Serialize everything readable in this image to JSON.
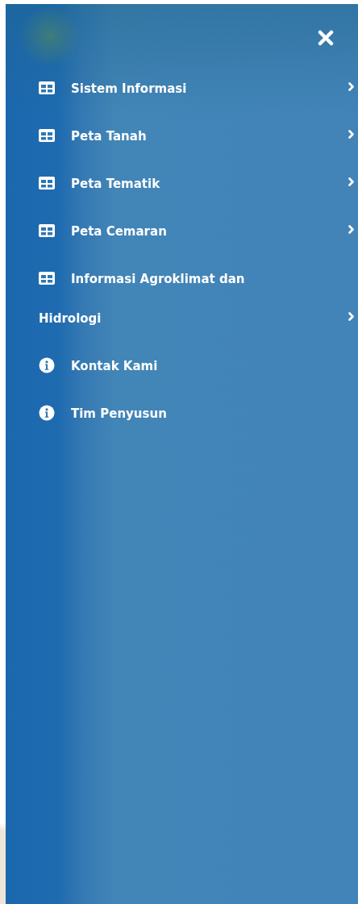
{
  "sidebar": {
    "items": [
      {
        "kind": "submenu",
        "label": "Sistem Informasi"
      },
      {
        "kind": "submenu",
        "label": "Peta Tanah"
      },
      {
        "kind": "submenu",
        "label": "Peta Tematik"
      },
      {
        "kind": "submenu",
        "label": "Peta Cemaran"
      },
      {
        "kind": "submenu",
        "label": "Informasi Agroklimat dan Hidrologi"
      },
      {
        "kind": "info",
        "label": "Kontak Kami"
      },
      {
        "kind": "info",
        "label": "Tim Penyusun"
      }
    ]
  }
}
